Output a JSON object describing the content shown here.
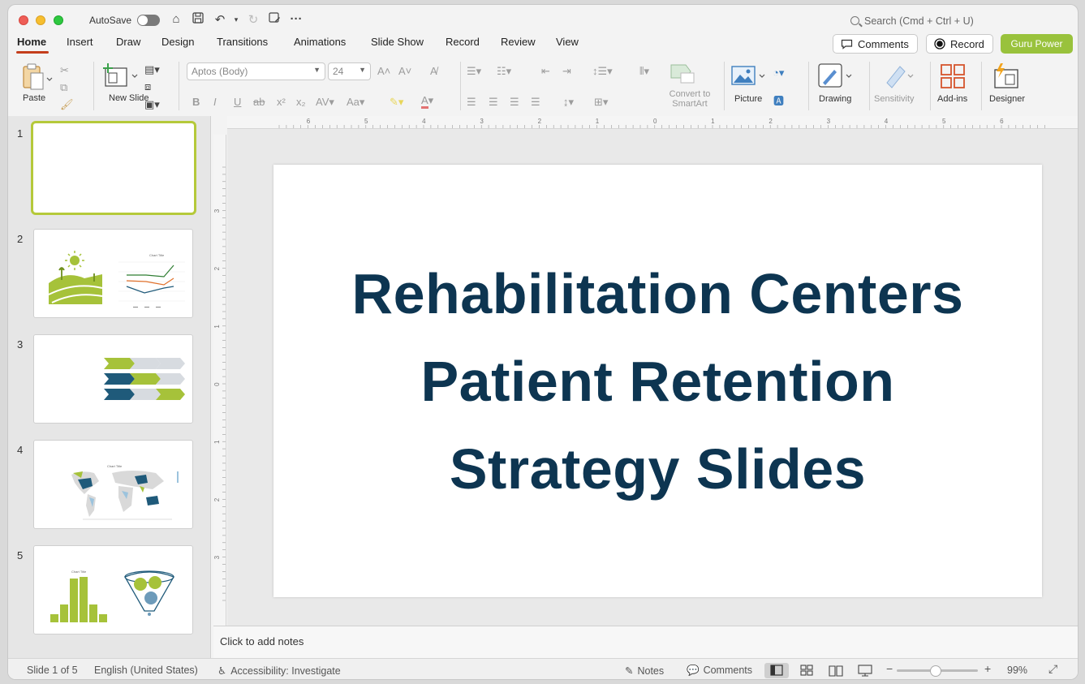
{
  "titlebar": {
    "autosave_label": "AutoSave",
    "search_placeholder": "Search (Cmd + Ctrl + U)"
  },
  "tabs": [
    "Home",
    "Insert",
    "Draw",
    "Design",
    "Transitions",
    "Animations",
    "Slide Show",
    "Record",
    "Review",
    "View"
  ],
  "header_buttons": {
    "comments": "Comments",
    "record": "Record",
    "guru": "Guru Power"
  },
  "ribbon": {
    "paste": "Paste",
    "new_slide": "New Slide",
    "font_name": "Aptos (Body)",
    "font_size": "24",
    "convert_smartart": "Convert to SmartArt",
    "picture": "Picture",
    "drawing": "Drawing",
    "sensitivity": "Sensitivity",
    "addins": "Add-ins",
    "designer": "Designer"
  },
  "slides": {
    "numbers": [
      "1",
      "2",
      "3",
      "4",
      "5"
    ],
    "thumb2_chart_title": "Chart Title",
    "thumb4_chart_title": "Chart Title",
    "thumb5_chart_title": "Chart Title"
  },
  "main_slide": {
    "title": "Rehabilitation Centers Patient Retention Strategy Slides"
  },
  "notes": {
    "placeholder": "Click to add notes"
  },
  "ruler": {
    "h_labels": [
      "6",
      "5",
      "4",
      "3",
      "2",
      "1",
      "0",
      "1",
      "2",
      "3",
      "4",
      "5",
      "6"
    ],
    "v_labels": [
      "3",
      "2",
      "1",
      "0",
      "1",
      "2",
      "3"
    ]
  },
  "status": {
    "slide_count": "Slide 1 of 5",
    "language": "English (United States)",
    "accessibility": "Accessibility: Investigate",
    "notes": "Notes",
    "comments": "Comments",
    "zoom": "99%"
  },
  "colors": {
    "accent_tab": "#c43e1c",
    "guru": "#99c23c",
    "title": "#0d3551",
    "green": "#a6c23a",
    "navy": "#1f5a7a"
  }
}
